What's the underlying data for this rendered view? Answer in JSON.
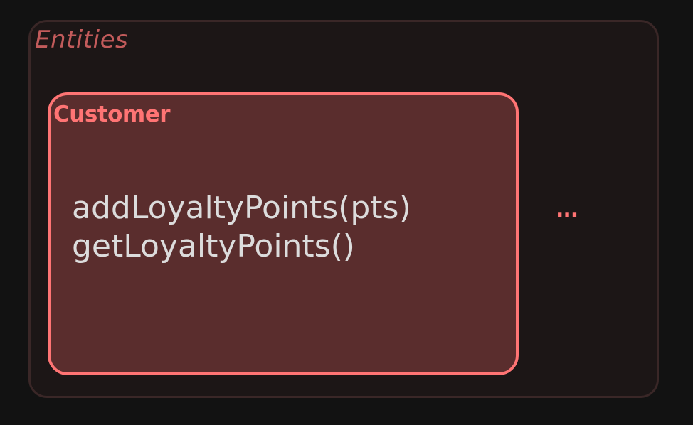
{
  "container": {
    "title": "Entities"
  },
  "entity": {
    "title": "Customer",
    "methods": [
      "addLoyaltyPoints(pts)",
      "getLoyaltyPoints()"
    ]
  },
  "more_indicator": "...",
  "colors": {
    "background": "#121212",
    "container_fill": "#1c1616",
    "container_border": "#3a2727",
    "container_title": "#c25b5b",
    "entity_fill": "#5a2d2d",
    "entity_border": "#ff7474",
    "method_text": "#dcdcdc"
  }
}
